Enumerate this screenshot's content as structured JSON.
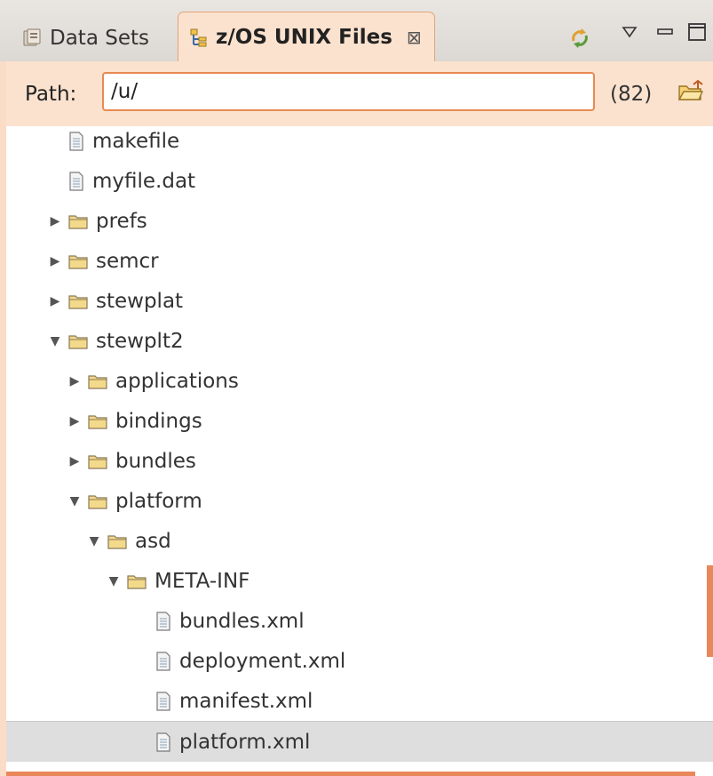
{
  "tabs": [
    {
      "label": "Data Sets",
      "active": false
    },
    {
      "label": "z/OS UNIX Files",
      "active": true
    }
  ],
  "toolbar": {
    "refresh_icon": "refresh-icon",
    "view_menu_icon": "view-menu-icon",
    "minimize_icon": "minimize-icon",
    "maximize_icon": "maximize-icon"
  },
  "path": {
    "label": "Path:",
    "value": "/u/",
    "count": "(82)"
  },
  "colors": {
    "accent": "#e8875a",
    "tab_active_bg": "#fbe2cf",
    "folder": "#e6c46a"
  },
  "tree": [
    {
      "label": "makefile",
      "type": "file",
      "depth": 1,
      "expanded": null
    },
    {
      "label": "myfile.dat",
      "type": "file",
      "depth": 1,
      "expanded": null
    },
    {
      "label": "prefs",
      "type": "folder",
      "depth": 1,
      "expanded": false
    },
    {
      "label": "semcr",
      "type": "folder",
      "depth": 1,
      "expanded": false
    },
    {
      "label": "stewplat",
      "type": "folder",
      "depth": 1,
      "expanded": false
    },
    {
      "label": "stewplt2",
      "type": "folder",
      "depth": 1,
      "expanded": true
    },
    {
      "label": "applications",
      "type": "folder",
      "depth": 2,
      "expanded": false
    },
    {
      "label": "bindings",
      "type": "folder",
      "depth": 2,
      "expanded": false
    },
    {
      "label": "bundles",
      "type": "folder",
      "depth": 2,
      "expanded": false
    },
    {
      "label": "platform",
      "type": "folder",
      "depth": 2,
      "expanded": true
    },
    {
      "label": "asd",
      "type": "folder",
      "depth": 3,
      "expanded": true
    },
    {
      "label": "META-INF",
      "type": "folder",
      "depth": 4,
      "expanded": true
    },
    {
      "label": "bundles.xml",
      "type": "file",
      "depth": 5,
      "expanded": null
    },
    {
      "label": "deployment.xml",
      "type": "file",
      "depth": 5,
      "expanded": null
    },
    {
      "label": "manifest.xml",
      "type": "file",
      "depth": 5,
      "expanded": null
    },
    {
      "label": "platform.xml",
      "type": "file",
      "depth": 5,
      "expanded": null,
      "selected": true
    }
  ]
}
